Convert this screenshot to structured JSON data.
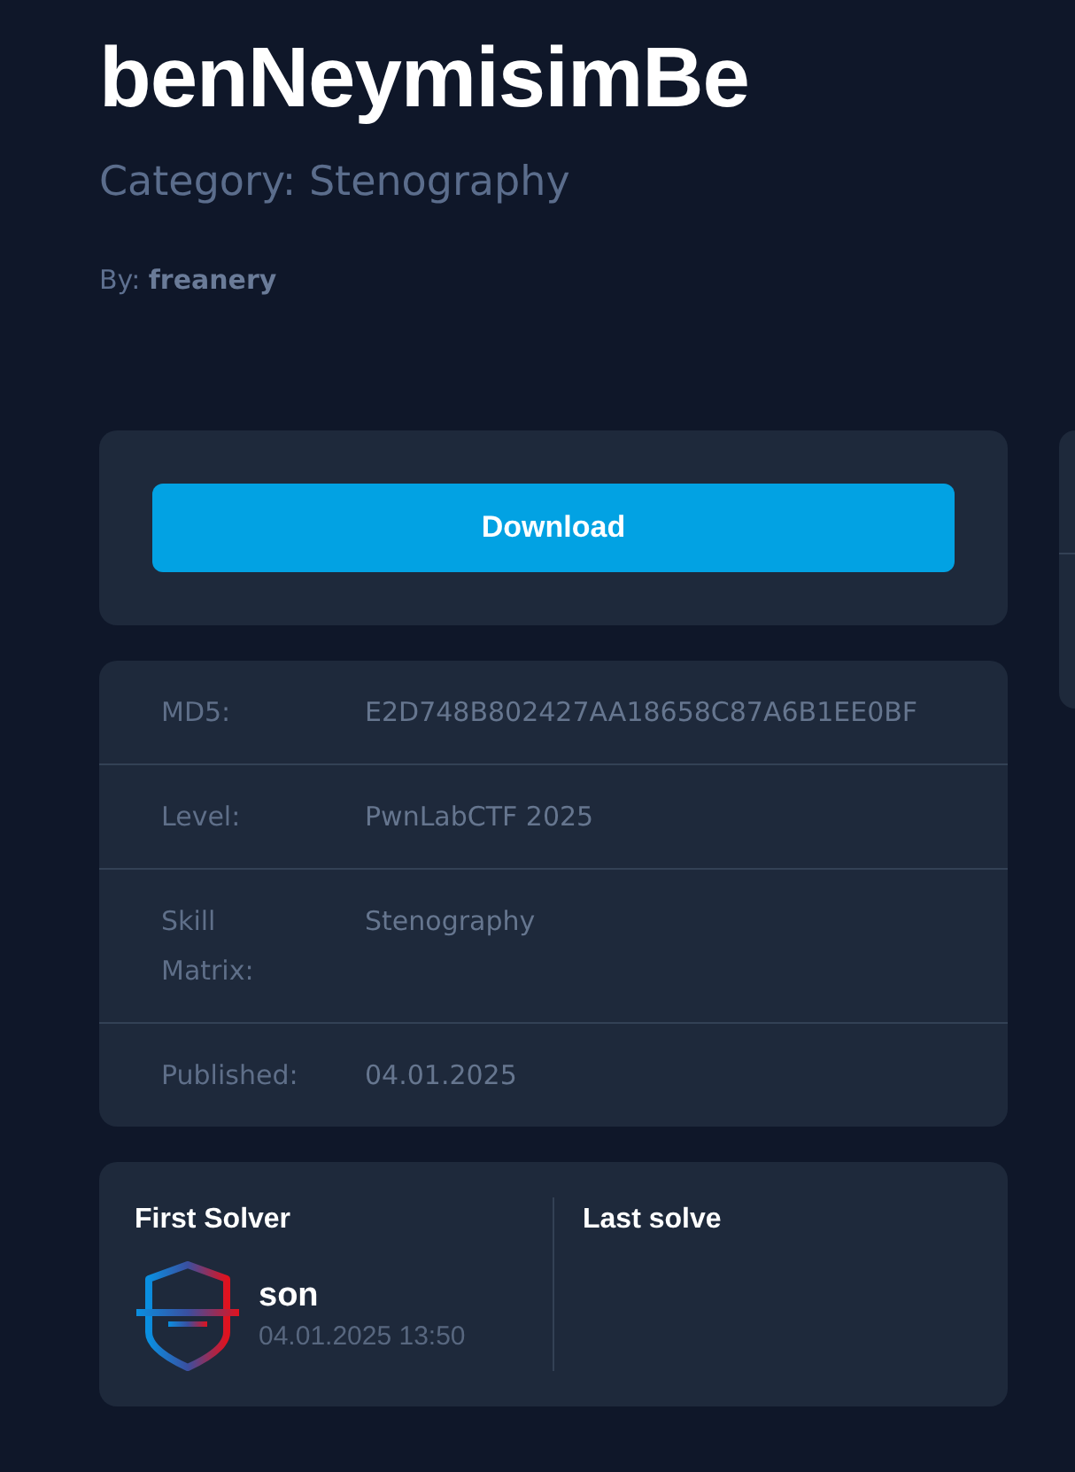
{
  "challenge": {
    "title": "benNeymisimBe",
    "category": "Category: Stenography",
    "author": "By: **freanery**"
  },
  "download_button": {
    "label": "Download"
  },
  "details": [
    {
      "label": "MD5:",
      "value": "E2D748B802427AA18658C87A6B1EE0BF"
    },
    {
      "label": "Level:",
      "value": "PwnLabCTF 2025"
    },
    {
      "label": "Skill Matrix:",
      "value": "Stenography"
    },
    {
      "label": "Published:",
      "value": "04.01.2025"
    }
  ],
  "solves": [
    {
      "heading": "First Solver",
      "solver": {
        "name": "son",
        "time": "04.01.2025 13:50"
      }
    },
    {
      "heading": "Last solve"
    }
  ]
}
